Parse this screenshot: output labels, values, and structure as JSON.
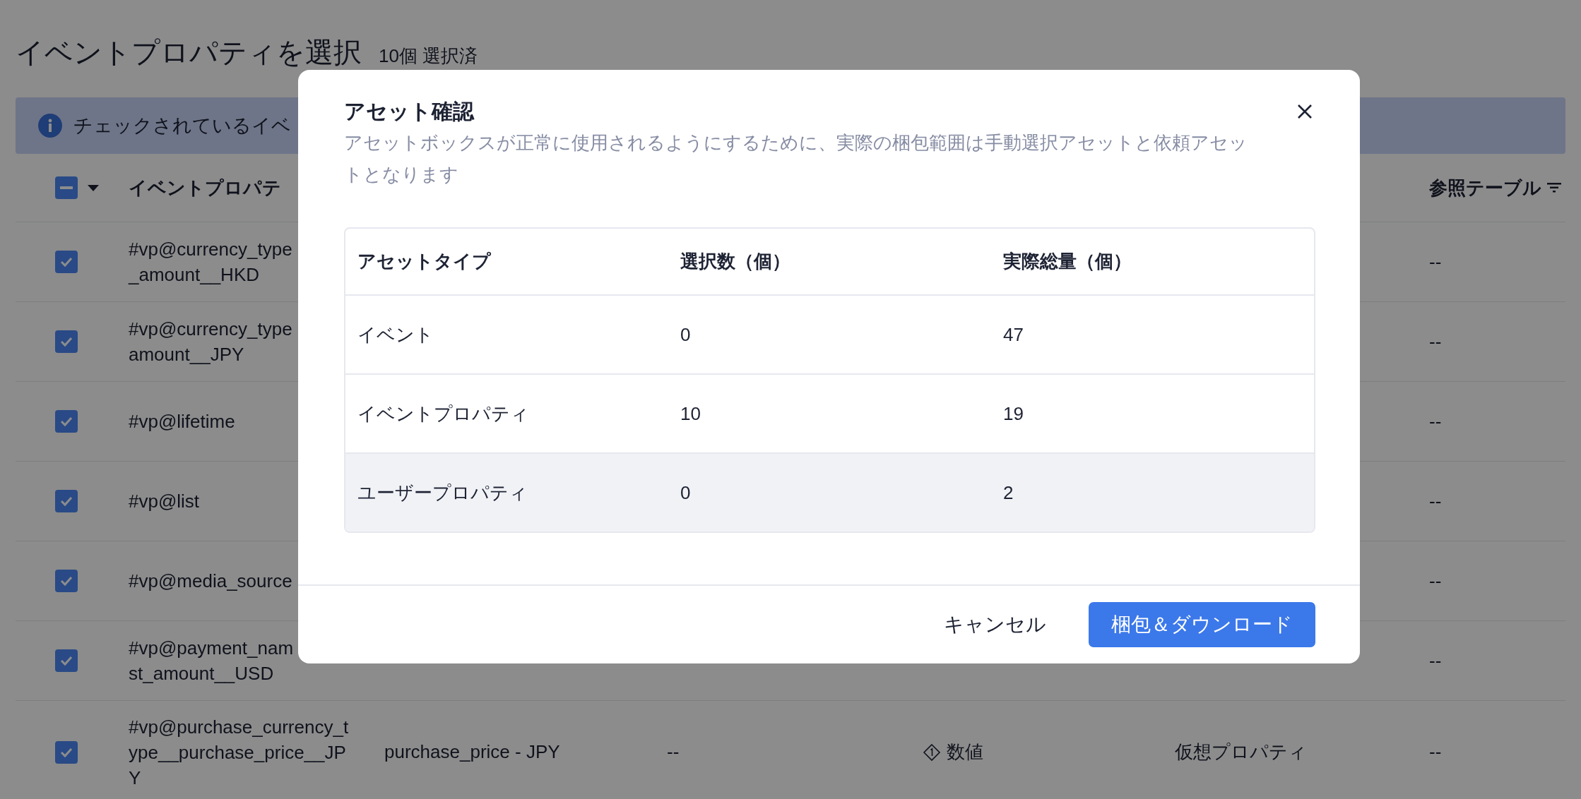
{
  "page": {
    "title": "イベントプロパティを選択",
    "selected_count": "10個 選択済"
  },
  "banner": {
    "text": "チェックされているイベ"
  },
  "table": {
    "header_indeterminate": true,
    "columns": [
      {
        "kind": "name",
        "label": "イベントプロパテ"
      },
      {
        "kind": "reference",
        "label": "参照テーブル"
      }
    ],
    "rows": [
      {
        "checked": true,
        "name": "#vp@currency_type\n_amount__HKD",
        "reference": "--"
      },
      {
        "checked": true,
        "name": "#vp@currency_type\namount__JPY",
        "reference": "--"
      },
      {
        "checked": true,
        "name": "#vp@lifetime",
        "reference": "--"
      },
      {
        "checked": true,
        "name": "#vp@list",
        "reference": "--"
      },
      {
        "checked": true,
        "name": "#vp@media_source",
        "reference": "--"
      },
      {
        "checked": true,
        "name": "#vp@payment_nam\nst_amount__USD",
        "reference": "--"
      },
      {
        "checked": true,
        "name": "#vp@purchase_currency_t\nype__purchase_price__JP\nY",
        "display_name": "purchase_price - JPY",
        "column_3": "--",
        "data_type": "数値",
        "property_type": "仮想プロパティ",
        "reference": "--"
      }
    ]
  },
  "modal": {
    "title": "アセット確認",
    "description": "アセットボックスが正常に使用されるようにするために、実際の梱包範囲は手動選択アセットと依頼アセットとなります",
    "columns": [
      "アセットタイプ",
      "選択数（個）",
      "実際総量（個）"
    ],
    "rows": [
      {
        "cells": [
          "イベント",
          "0",
          "47"
        ],
        "hovered": false
      },
      {
        "cells": [
          "イベントプロパティ",
          "10",
          "19"
        ],
        "hovered": false
      },
      {
        "cells": [
          "ユーザープロパティ",
          "0",
          "2"
        ],
        "hovered": true
      }
    ],
    "cancel": "キャンセル",
    "confirm": "梱包＆ダウンロード"
  }
}
